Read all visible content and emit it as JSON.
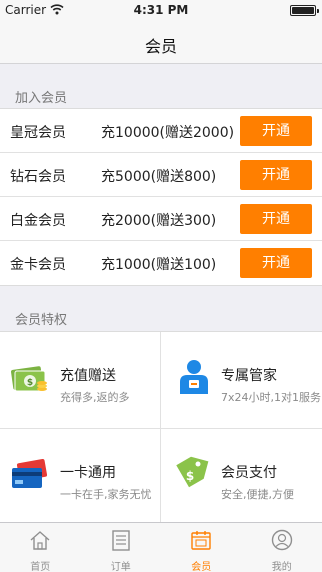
{
  "status": {
    "carrier": "Carrier",
    "time": "4:31 PM"
  },
  "nav": {
    "title": "会员"
  },
  "join_section": {
    "title": "加入会员",
    "rows": [
      {
        "name": "皇冠会员",
        "price": "充10000(赠送2000)",
        "button": "开通"
      },
      {
        "name": "钻石会员",
        "price": "充5000(赠送800)",
        "button": "开通"
      },
      {
        "name": "白金会员",
        "price": "充2000(赠送300)",
        "button": "开通"
      },
      {
        "name": "金卡会员",
        "price": "充1000(赠送100)",
        "button": "开通"
      }
    ]
  },
  "benefits_section": {
    "title": "会员特权",
    "items": [
      {
        "icon": "cash-icon",
        "title": "充值赠送",
        "desc": "充得多,返的多"
      },
      {
        "icon": "butler-icon",
        "title": "专属管家",
        "desc": "7x24小时,1对1服务"
      },
      {
        "icon": "card-icon",
        "title": "一卡通用",
        "desc": "一卡在手,家务无忧"
      },
      {
        "icon": "price-tag-icon",
        "title": "会员支付",
        "desc": "安全,便捷,方便"
      }
    ]
  },
  "tabbar": {
    "items": [
      {
        "icon": "home-icon",
        "label": "首页"
      },
      {
        "icon": "orders-icon",
        "label": "订单"
      },
      {
        "icon": "calendar-icon",
        "label": "会员"
      },
      {
        "icon": "profile-icon",
        "label": "我的"
      }
    ],
    "active_index": 2
  },
  "colors": {
    "accent": "#ff7f00",
    "background": "#efeff4"
  }
}
